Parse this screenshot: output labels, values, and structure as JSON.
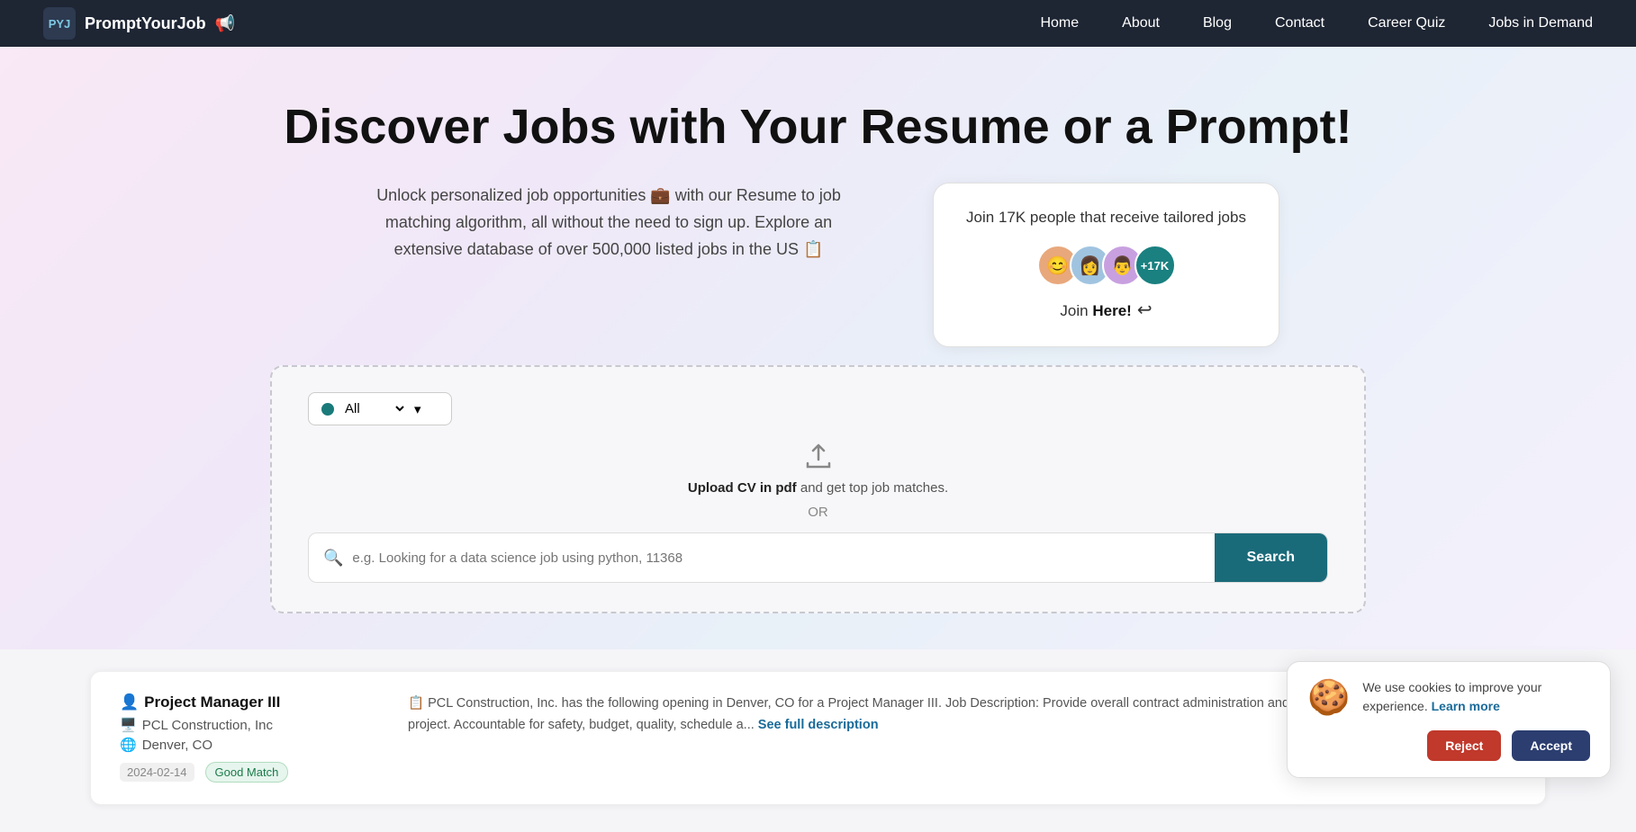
{
  "nav": {
    "brand": "PromptYourJob",
    "brand_emoji": "📢",
    "logo_text": "PYJ",
    "links": [
      {
        "label": "Home",
        "id": "home"
      },
      {
        "label": "About",
        "id": "about"
      },
      {
        "label": "Blog",
        "id": "blog"
      },
      {
        "label": "Contact",
        "id": "contact"
      },
      {
        "label": "Career Quiz",
        "id": "career-quiz"
      },
      {
        "label": "Jobs in Demand",
        "id": "jobs-in-demand"
      }
    ]
  },
  "hero": {
    "title": "Discover Jobs with Your Resume or a Prompt!",
    "body_text": "Unlock personalized job opportunities 💼 with our Resume to job matching algorithm, all without the need to sign up. Explore an extensive database of over 500,000 listed jobs in the US 📋",
    "card": {
      "title": "Join 17K people that receive tailored jobs",
      "plus_label": "+17K",
      "join_text": "Join ",
      "join_cta": "Here!",
      "arrow": "↩"
    }
  },
  "search": {
    "location_dot": "●",
    "location_label": "All",
    "upload_label_bold": "Upload CV in pdf",
    "upload_label_rest": " and get top job matches.",
    "or_label": "OR",
    "placeholder": "e.g. Looking for a data science job using python, 11368",
    "search_button": "Search"
  },
  "jobs": [
    {
      "title_emoji": "👤",
      "title": "Project Manager III",
      "company_emoji": "🖥️",
      "company": "PCL Construction, Inc",
      "location_emoji": "🌐",
      "location": "Denver, CO",
      "date": "2024-02-14",
      "badge": "Good Match",
      "desc_emoji": "📋",
      "description": "PCL Construction, Inc. has the following opening in Denver, CO for a Project Manager III. Job Description: Provide overall contract administration and technical expertise for a construction project. Accountable for safety, budget, quality, schedule a...",
      "see_full": "See full description"
    }
  ],
  "cookie": {
    "icon": "🍪",
    "text": "We use cookies to improve your experience.",
    "learn_more": "Learn more",
    "reject_label": "Reject",
    "accept_label": "Accept"
  }
}
